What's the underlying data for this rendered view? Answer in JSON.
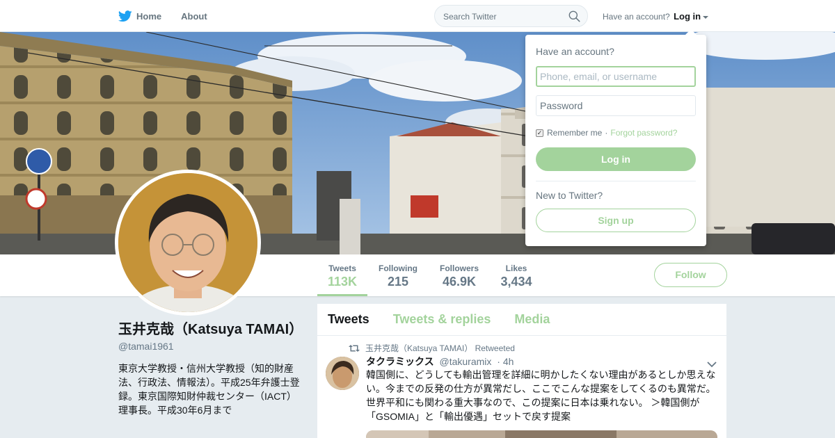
{
  "nav": {
    "home_label": "Home",
    "about_label": "About",
    "search_placeholder": "Search Twitter",
    "have_account": "Have an account?",
    "login_label": "Log in"
  },
  "stats": [
    {
      "label": "Tweets",
      "value": "113K"
    },
    {
      "label": "Following",
      "value": "215"
    },
    {
      "label": "Followers",
      "value": "46.9K"
    },
    {
      "label": "Likes",
      "value": "3,434"
    }
  ],
  "follow_label": "Follow",
  "profile": {
    "name": "玉井克哉（Katsuya TAMAI）",
    "handle": "@tamai1961",
    "bio": "東京大学教授・信州大学教授（知的財産法、行政法、情報法）。平成25年弁護士登録。東京国際知財仲裁センター（IACT）理事長。平成30年6月まで"
  },
  "timeline": {
    "tabs": [
      "Tweets",
      "Tweets & replies",
      "Media"
    ],
    "retweet_line": "玉井克哉（Katsuya TAMAI） Retweeted",
    "tweet": {
      "name": "タクラミックス",
      "handle": "@takuramix",
      "time": "· 4h",
      "text": "韓国側に、どうしても輸出管理を詳細に明かしたくない理由があるとしか思えない。今までの反発の仕方が異常だし、ここでこんな提案をしてくるのも異常だ。世界平和にも関わる重大事なので、この提案に日本は乗れない。 ＞韓国側が「GSOMIA」と「輸出優遇」セットで戻す提案"
    }
  },
  "login_dropdown": {
    "title": "Have an account?",
    "username_placeholder": "Phone, email, or username",
    "password_placeholder": "Password",
    "remember_label": "Remember me",
    "separator": "·",
    "forgot_label": "Forgot password?",
    "login_button": "Log in",
    "new_to": "New to Twitter?",
    "signup_button": "Sign up"
  },
  "colors": {
    "accent": "#a3d39c",
    "twitter_blue": "#1da1f2",
    "text_secondary": "#657786"
  }
}
